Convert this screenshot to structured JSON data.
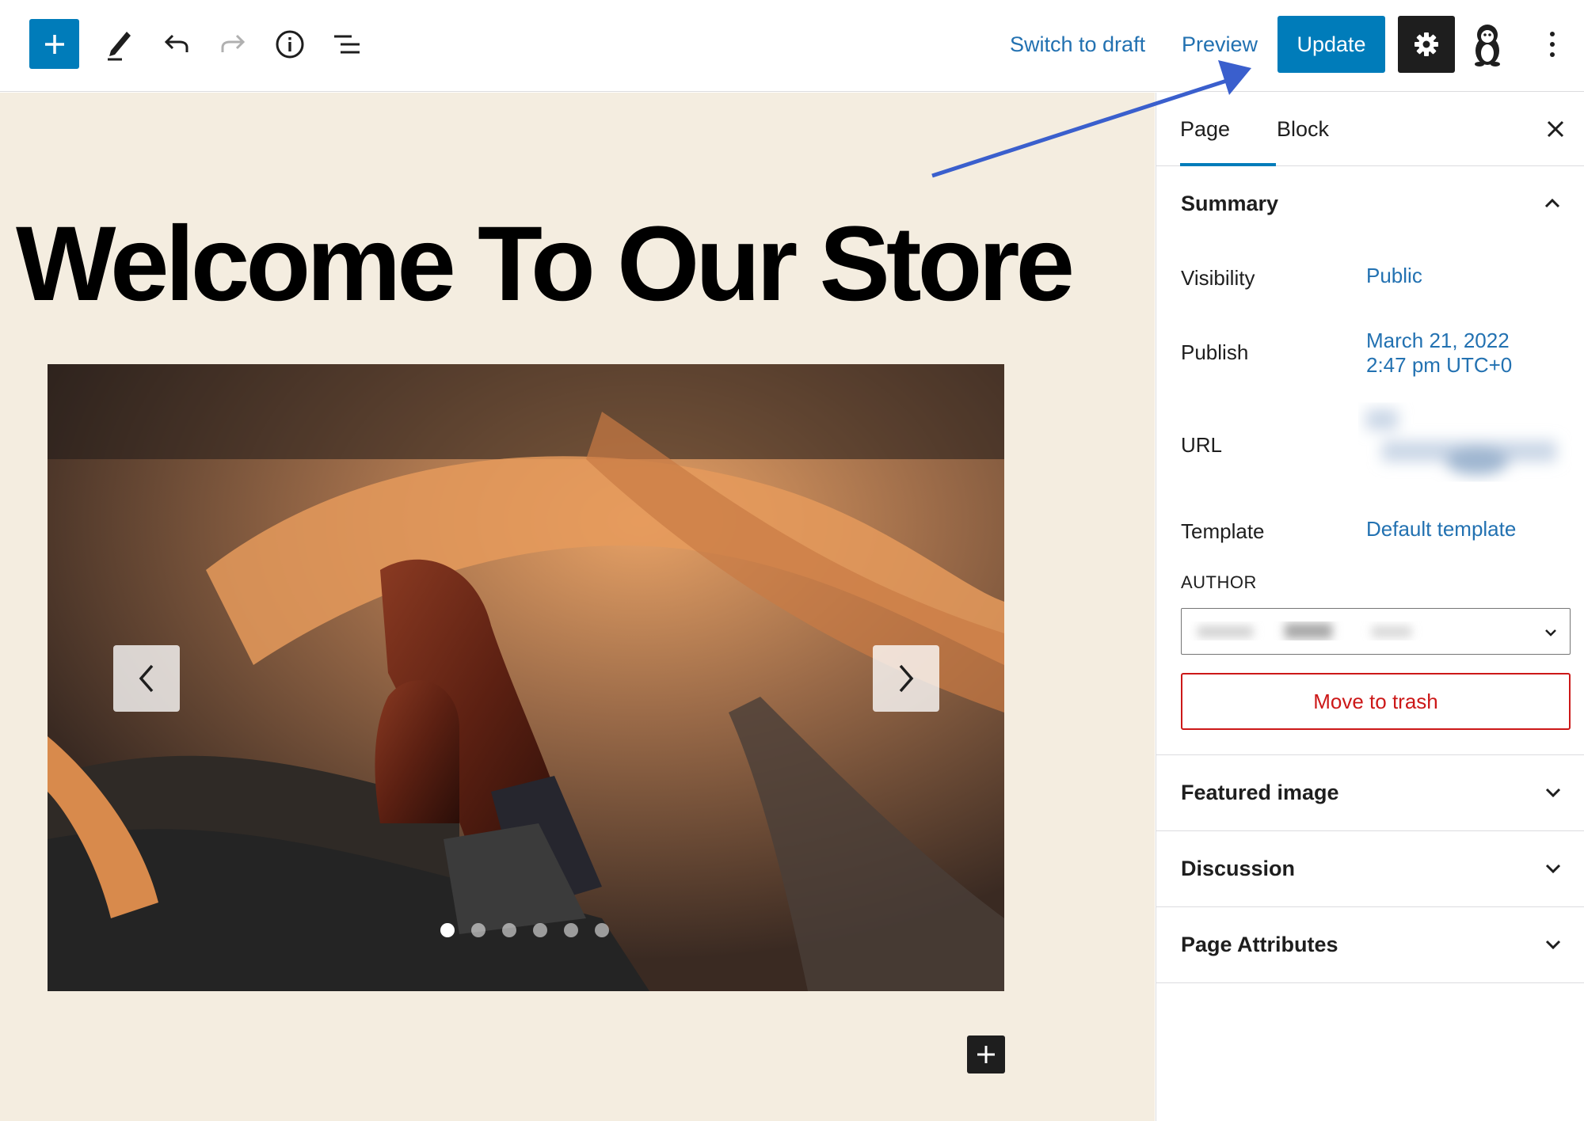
{
  "toolbar": {
    "switch_to_draft": "Switch to draft",
    "preview": "Preview",
    "update": "Update",
    "icons": [
      "plus-icon",
      "pencil-icon",
      "undo-icon",
      "redo-icon",
      "info-icon",
      "list-view-icon",
      "gear-icon",
      "user-avatar-icon",
      "more-vertical-icon"
    ]
  },
  "canvas": {
    "title": "Welcome To Our Store",
    "slider": {
      "slide_count": 6,
      "active_slide": 1
    }
  },
  "sidebar": {
    "tabs": [
      {
        "label": "Page",
        "active": true
      },
      {
        "label": "Block",
        "active": false
      }
    ],
    "summary": {
      "heading": "Summary",
      "visibility_label": "Visibility",
      "visibility_value": "Public",
      "publish_label": "Publish",
      "publish_date": "March 21, 2022",
      "publish_time": "2:47 pm UTC+0",
      "url_label": "URL",
      "template_label": "Template",
      "template_value": "Default template",
      "author_label": "AUTHOR",
      "trash_label": "Move to trash"
    },
    "panels": [
      {
        "label": "Featured image"
      },
      {
        "label": "Discussion"
      },
      {
        "label": "Page Attributes"
      }
    ]
  },
  "colors": {
    "accent": "#007cba",
    "link": "#2271b1",
    "danger": "#cc1818",
    "canvas_bg": "#f4ede0",
    "annotation_arrow": "#3a5fcd"
  }
}
